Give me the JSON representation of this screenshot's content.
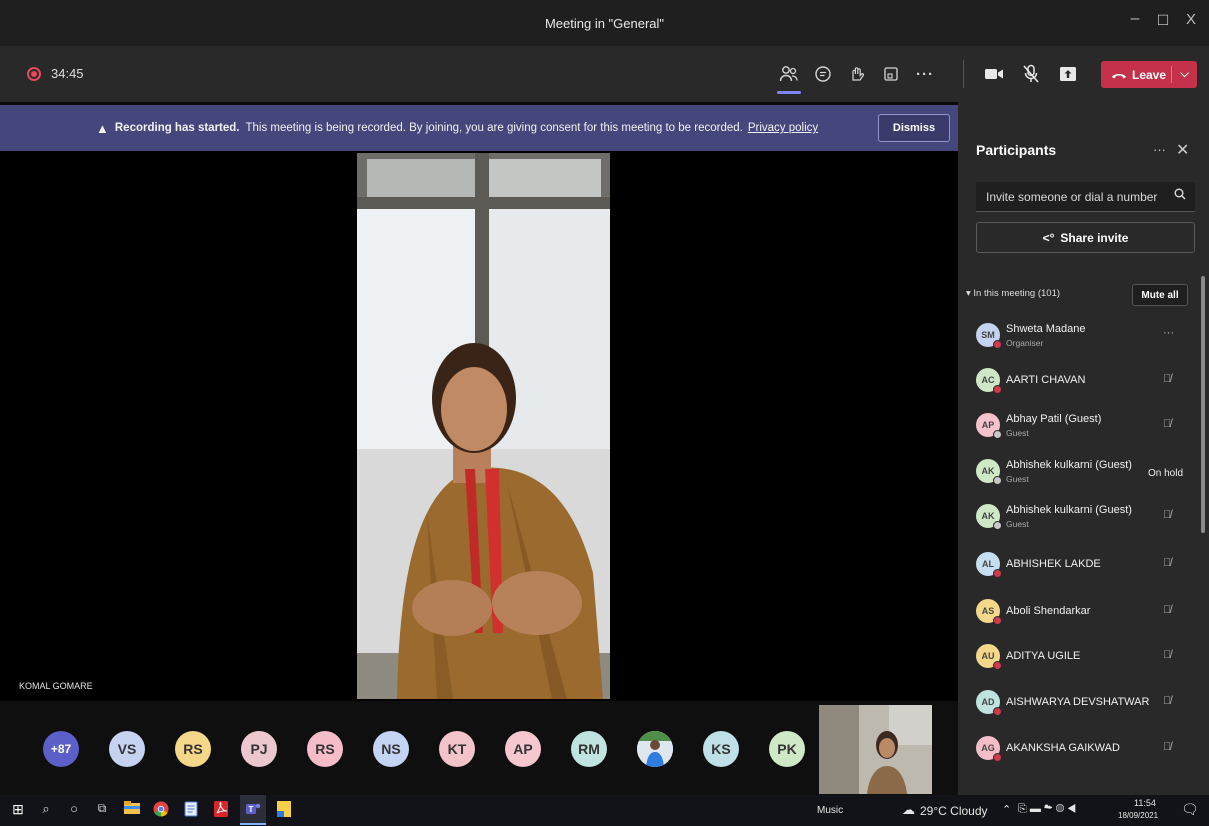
{
  "window": {
    "title": "Meeting in \"General\"",
    "minimize": "–",
    "maximize": "☐",
    "close": "X"
  },
  "toolbar": {
    "timer": "34:45",
    "icons": [
      "people-icon",
      "chat-icon",
      "raise-hand-icon",
      "rooms-icon",
      "more-icon",
      "camera-icon",
      "mic-off-icon",
      "share-screen-icon"
    ],
    "leave_label": "Leave",
    "leave_color": "#c4314b"
  },
  "banner": {
    "bold": "Recording has started.",
    "text": "This meeting is being recorded. By joining, you are giving consent for this meeting to be recorded.",
    "link": "Privacy policy",
    "dismiss": "Dismiss"
  },
  "stage": {
    "speaker_name": "KOMAL GOMARE"
  },
  "strip": {
    "avatars": [
      {
        "initials": "+87",
        "color": "#5b5fc7"
      },
      {
        "initials": "VS",
        "color": "#c6d3f0"
      },
      {
        "initials": "RS",
        "color": "#f5d78a"
      },
      {
        "initials": "PJ",
        "color": "#ecc7cd"
      },
      {
        "initials": "RS",
        "color": "#f4bdc7"
      },
      {
        "initials": "NS",
        "color": "#c4d5f4"
      },
      {
        "initials": "KT",
        "color": "#f2c3c9"
      },
      {
        "initials": "AP",
        "color": "#f6c7cf"
      },
      {
        "initials": "RM",
        "color": "#bfe4e0"
      },
      {
        "initials": "",
        "color": "#d9e2ea"
      },
      {
        "initials": "KS",
        "color": "#bfe0e6"
      },
      {
        "initials": "PK",
        "color": "#cfe9c6"
      }
    ]
  },
  "panel": {
    "title": "Participants",
    "invite_placeholder": "Invite someone or dial a number",
    "share_invite": "Share invite",
    "section_label": "In this meeting (101)",
    "mute_all": "Mute all",
    "participants": [
      {
        "initials": "SM",
        "name": "Shweta Madane",
        "role": "Organiser",
        "color": "#c5d2f0",
        "status": "more"
      },
      {
        "initials": "AC",
        "name": "AARTI CHAVAN",
        "role": "",
        "color": "#cfe9c6",
        "status": "mic-off"
      },
      {
        "initials": "AP",
        "name": "Abhay Patil (Guest)",
        "role": "Guest",
        "color": "#f4c2cb",
        "status": "mic-off"
      },
      {
        "initials": "AK",
        "name": "Abhishek kulkarni (Guest)",
        "role": "Guest",
        "color": "#cfe9c6",
        "status": "On hold"
      },
      {
        "initials": "AK",
        "name": "Abhishek kulkarni (Guest)",
        "role": "Guest",
        "color": "#cfe9c6",
        "status": "mic-off"
      },
      {
        "initials": "AL",
        "name": "ABHISHEK LAKDE",
        "role": "",
        "color": "#c6dff0",
        "status": "mic-off"
      },
      {
        "initials": "AS",
        "name": "Aboli Shendarkar",
        "role": "",
        "color": "#f5d78a",
        "status": "mic-off"
      },
      {
        "initials": "AU",
        "name": "ADITYA UGILE",
        "role": "",
        "color": "#f5d78a",
        "status": "mic-off"
      },
      {
        "initials": "AD",
        "name": "AISHWARYA DEVSHATWAR",
        "role": "",
        "color": "#bfe4e0",
        "status": "mic-off"
      },
      {
        "initials": "AG",
        "name": "AKANKSHA GAIKWAD",
        "role": "",
        "color": "#f4bdc7",
        "status": "mic-off"
      }
    ]
  },
  "taskbar": {
    "music": "Music",
    "weather": "29°C Cloudy",
    "time": "11:54",
    "date": "18/09/2021"
  }
}
